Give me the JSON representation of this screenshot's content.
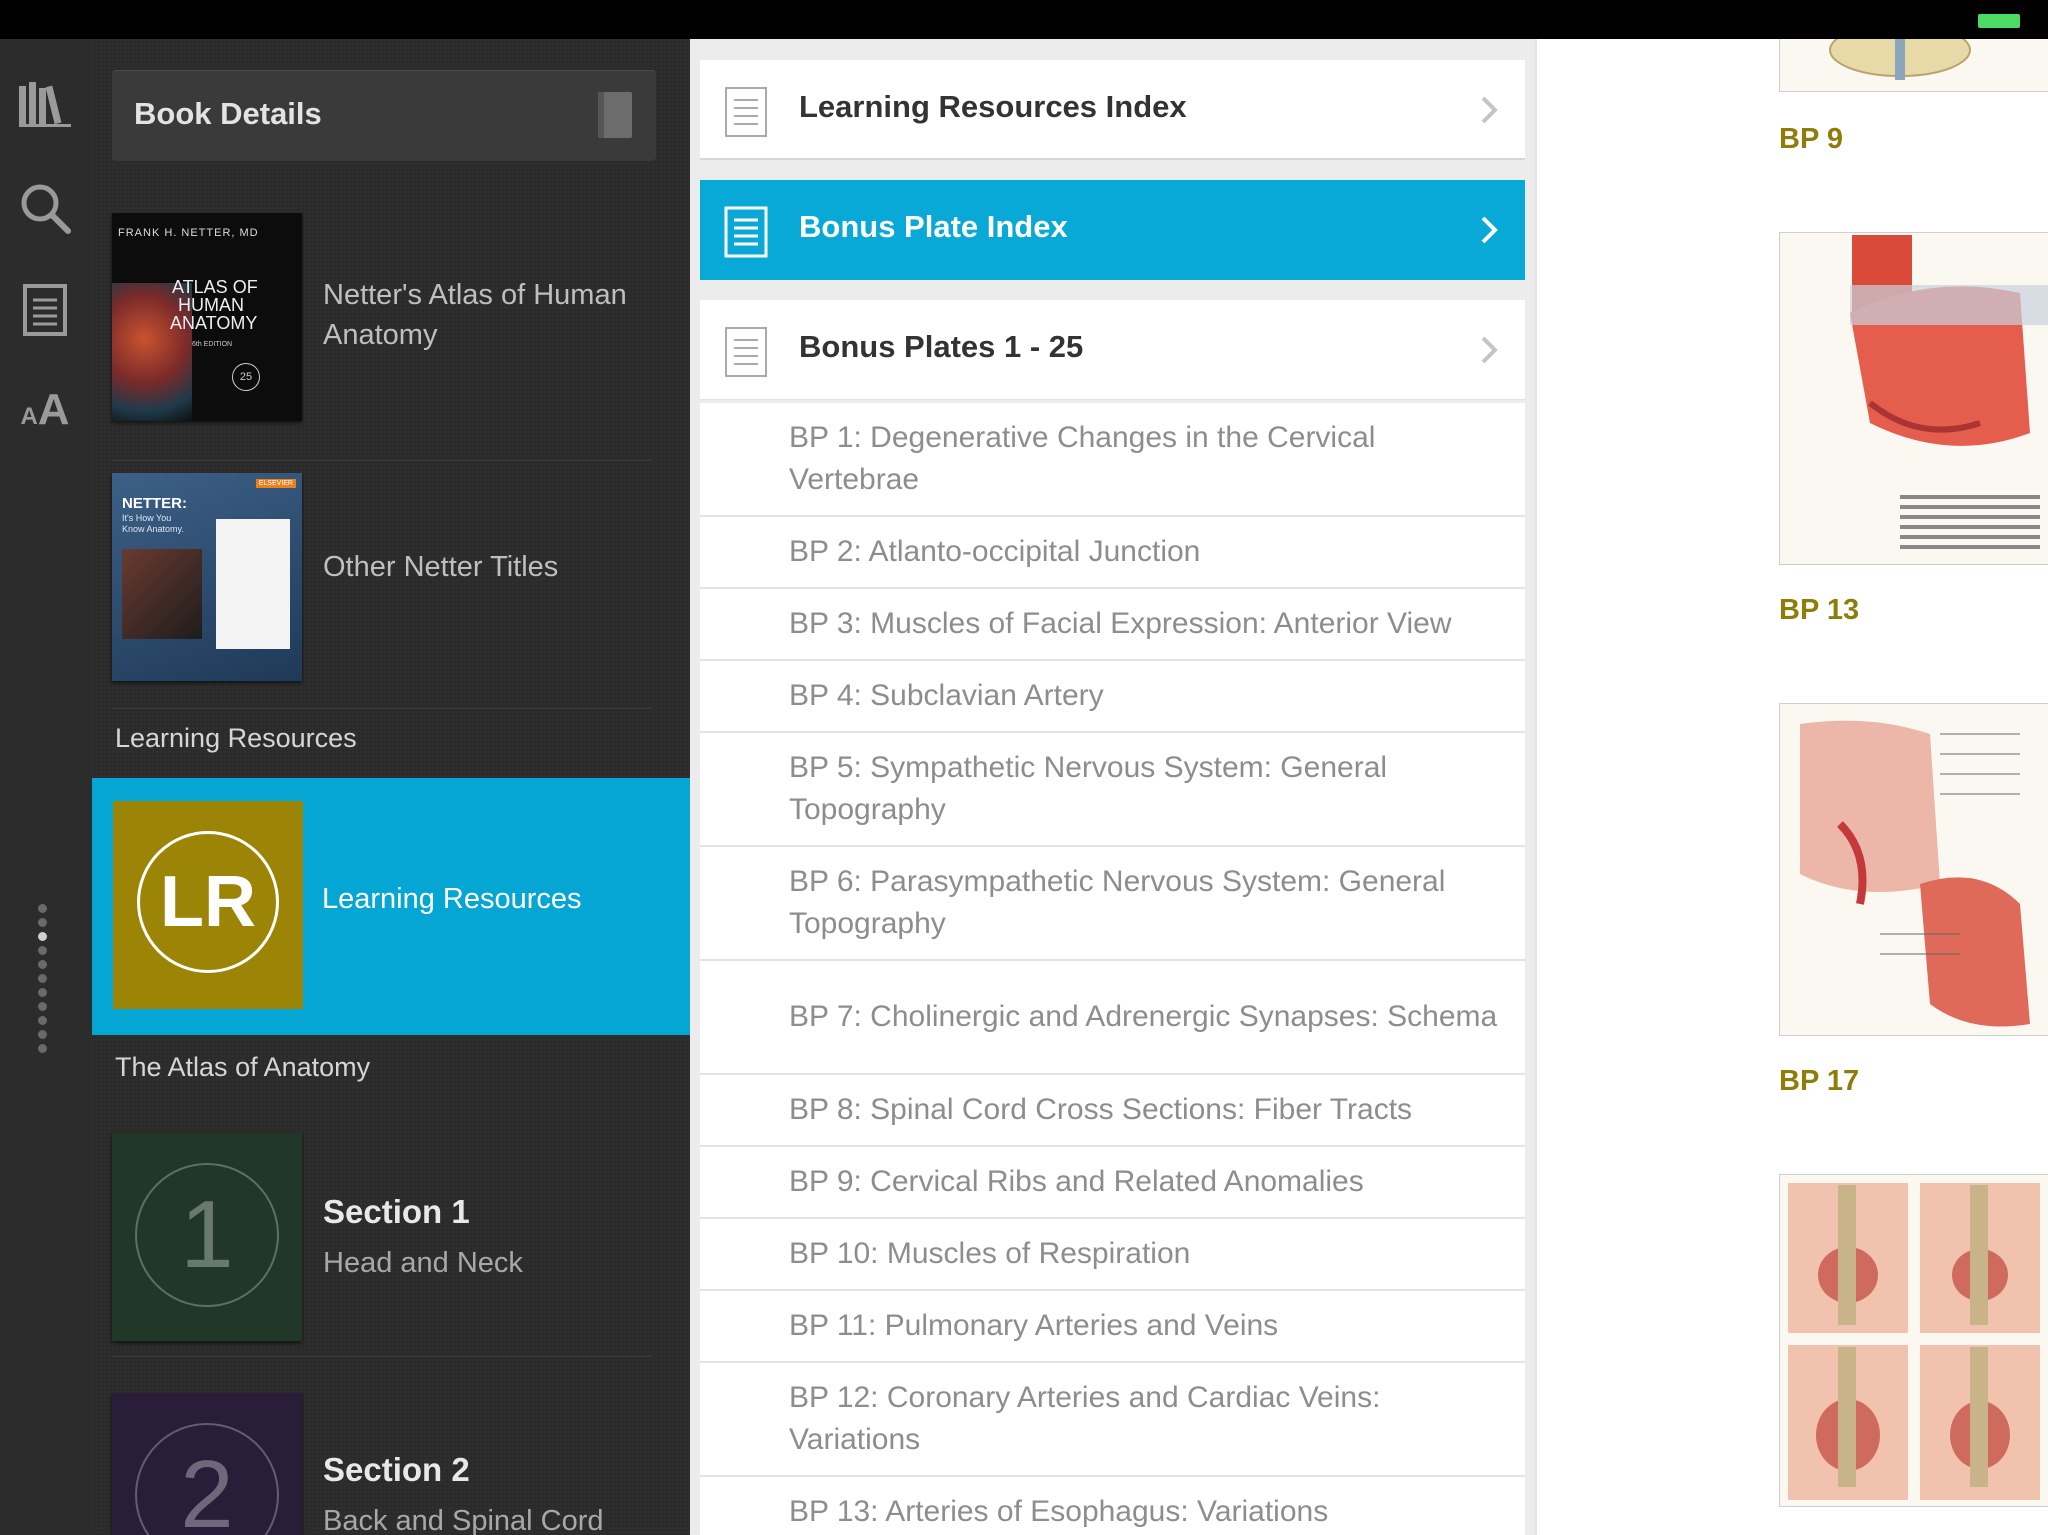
{
  "rail": {
    "icons": [
      "library-icon",
      "search-icon",
      "contents-icon",
      "font-size-icon"
    ],
    "font_size_label_small": "A",
    "font_size_label_large": "A"
  },
  "library": {
    "details_button": "Book Details",
    "books": [
      {
        "title": "Netter's Atlas of Human Anatomy",
        "cover_author": "FRANK H. NETTER, MD",
        "cover_title_1": "ATLAS OF",
        "cover_title_2": "HUMAN",
        "cover_title_3": "ANATOMY",
        "cover_edition": "6th EDITION",
        "cover_badge": "25"
      },
      {
        "title": "Other Netter Titles",
        "cover_headline": "NETTER:",
        "cover_sub_1": "It's How You",
        "cover_sub_2": "Know Anatomy.",
        "cover_publisher": "ELSEVIER"
      }
    ],
    "group_learning": "Learning Resources",
    "learning_tile": {
      "initials": "LR",
      "title": "Learning Resources"
    },
    "group_atlas": "The Atlas of Anatomy",
    "sections": [
      {
        "number": "1",
        "title": "Section 1",
        "subtitle": "Head and Neck",
        "color": "#213829"
      },
      {
        "number": "2",
        "title": "Section 2",
        "subtitle": "Back and Spinal Cord",
        "color": "#2a1d3a"
      }
    ]
  },
  "index": {
    "rows": [
      {
        "label": "Learning Resources Index",
        "selected": false
      },
      {
        "label": "Bonus Plate Index",
        "selected": true
      },
      {
        "label": "Bonus Plates 1 - 25",
        "selected": false
      }
    ],
    "plates": [
      "BP 1: Degenerative Changes in the Cervical Vertebrae",
      "BP 2: Atlanto-occipital Junction",
      "BP 3: Muscles of Facial Expression: Anterior View",
      "BP 4: Subclavian Artery",
      "BP 5: Sympathetic Nervous System: General Topography",
      "BP 6: Parasympathetic Nervous System: General Topography",
      "BP 7: Cholinergic and Adrenergic Synapses: Schema",
      "BP 8: Spinal Cord Cross Sections: Fiber Tracts",
      "BP 9: Cervical Ribs and Related Anomalies",
      "BP 10: Muscles of Respiration",
      "BP 11: Pulmonary Arteries and Veins",
      "BP 12: Coronary Arteries and Cardiac Veins: Variations",
      "BP 13: Arteries of Esophagus: Variations"
    ]
  },
  "thumbnails": {
    "labels": [
      "BP 9",
      "BP 13",
      "BP 17"
    ]
  },
  "colors": {
    "accent": "#08a9d6",
    "learning_tile": "#9c8506",
    "plate_label": "#8f7d0a"
  }
}
